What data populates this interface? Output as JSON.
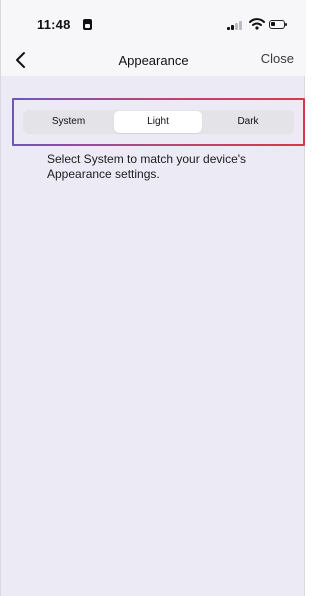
{
  "status_bar": {
    "time": "11:48"
  },
  "nav": {
    "title": "Appearance",
    "close_label": "Close"
  },
  "appearance_selector": {
    "options": [
      "System",
      "Light",
      "Dark"
    ],
    "selected": "Light"
  },
  "description": "Select System to match your device's Appearance settings."
}
